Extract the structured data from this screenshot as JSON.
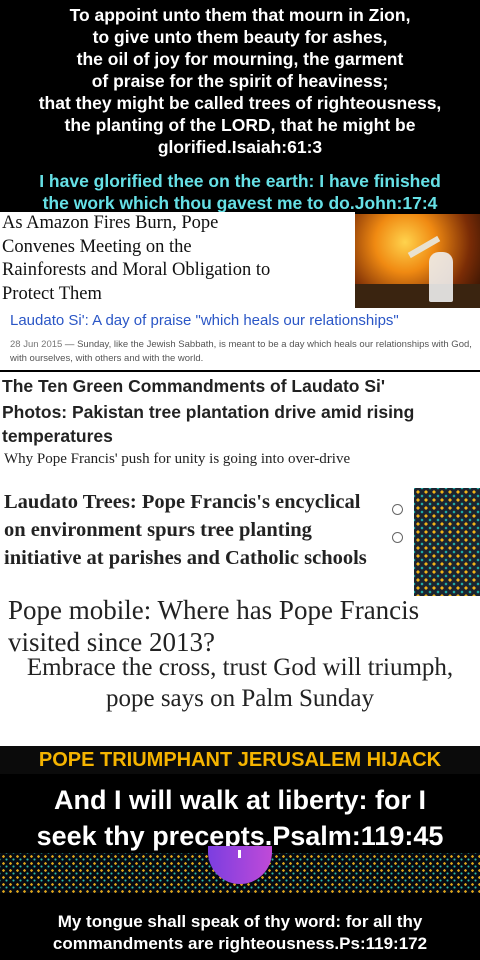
{
  "verse_top": {
    "lines": [
      "To appoint unto them that mourn in Zion,",
      "to give unto them beauty for ashes,",
      "the oil of joy for mourning, the garment",
      "of praise for the spirit of heaviness;",
      "that they might be called trees of righteousness,",
      "the planting of the LORD, that he might be",
      "glorified.Isaiah:61:3"
    ]
  },
  "verse_john": {
    "lines": [
      "I have glorified thee on the earth: I have finished",
      "the work which thou gavest me to do.John:17:4"
    ],
    "color": "#66e0e6"
  },
  "headline_amazon": {
    "lines": [
      "As Amazon Fires Burn, Pope",
      "Convenes Meeting on the",
      "Rainforests and Moral Obligation to",
      "Protect Them"
    ]
  },
  "laudato_card": {
    "title": "Laudato Si': A day of praise \"which heals our relationships\"",
    "date": "28 Jun 2015",
    "snippet": " — Sunday, like the Jewish Sabbath, is meant to be a day which heals our relationships with God, with ourselves, with others and with the world."
  },
  "headline_ten": "The Ten Green Commandments of Laudato Si'",
  "headline_pakistan": "Photos: Pakistan tree plantation drive amid rising temperatures",
  "headline_unity": "Why Pope Francis' push for unity is going into over-drive",
  "headline_trees": "Laudato Trees: Pope Francis's encyclical on environment spurs tree planting initiative at parishes and Catholic schools",
  "headline_popemobile": "Pope mobile: Where has Pope Francis visited since 2013?",
  "headline_embrace": "Embrace the cross, trust God will triumph, pope says on Palm Sunday",
  "banner_triumph": {
    "text": "POPE TRIUMPHANT JERUSALEM HIJACK",
    "color": "#f5b400"
  },
  "verse_psalm_119_45": {
    "lines": [
      "And I will walk at liberty: for I",
      "seek thy precepts.Psalm:119:45"
    ]
  },
  "verse_psalm_119_172": {
    "lines": [
      "My tongue shall speak of thy word: for all thy",
      "commandments are righteousness.Ps:119:172"
    ]
  }
}
